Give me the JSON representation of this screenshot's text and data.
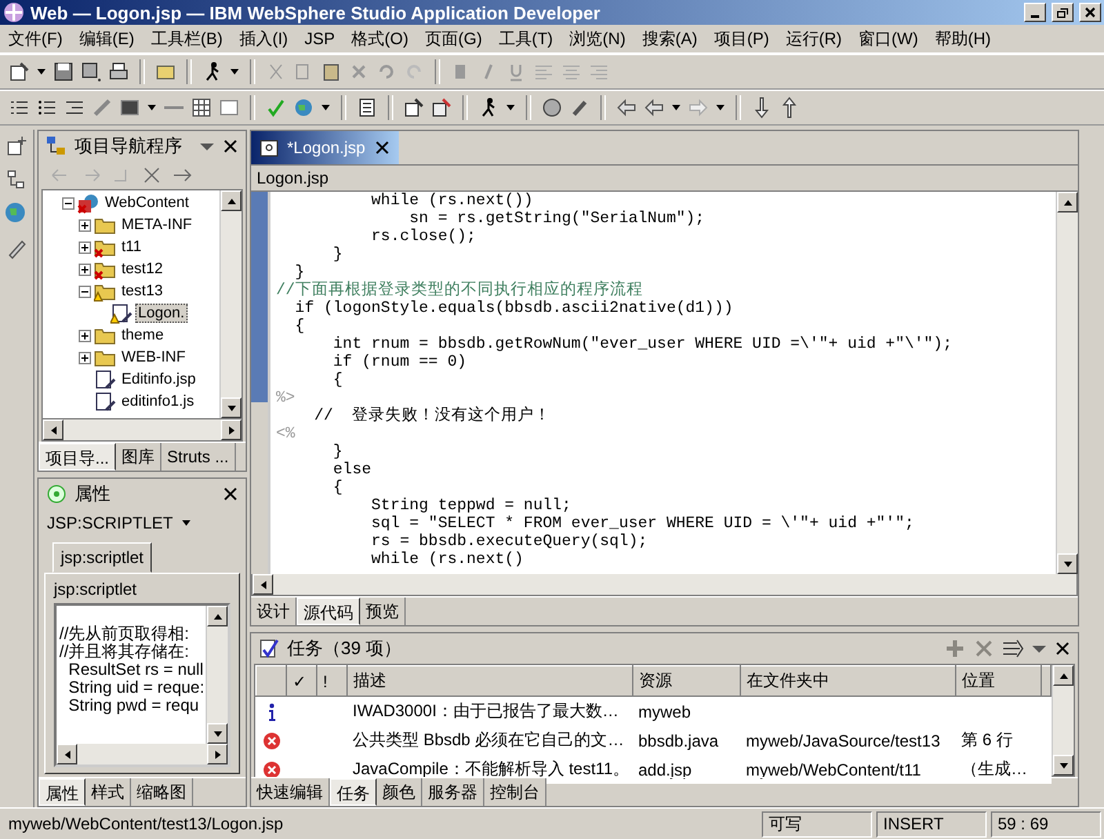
{
  "window": {
    "title": "Web — Logon.jsp — IBM WebSphere Studio Application Developer"
  },
  "menu": [
    "文件(F)",
    "编辑(E)",
    "工具栏(B)",
    "插入(I)",
    "JSP",
    "格式(O)",
    "页面(G)",
    "工具(T)",
    "浏览(N)",
    "搜索(A)",
    "项目(P)",
    "运行(R)",
    "窗口(W)",
    "帮助(H)"
  ],
  "navigator": {
    "title": "项目导航程序",
    "tree": [
      {
        "label": "WebContent",
        "kind": "project",
        "error": true,
        "warning": false,
        "expanded": true,
        "selected": false,
        "children": [
          {
            "label": "META-INF",
            "kind": "folder",
            "error": false,
            "warning": false,
            "expanded": false,
            "selected": false
          },
          {
            "label": "t11",
            "kind": "folder",
            "error": true,
            "warning": false,
            "expanded": false,
            "selected": false
          },
          {
            "label": "test12",
            "kind": "folder",
            "error": true,
            "warning": false,
            "expanded": false,
            "selected": false
          },
          {
            "label": "test13",
            "kind": "folder",
            "error": false,
            "warning": true,
            "expanded": true,
            "selected": false,
            "children": [
              {
                "label": "Logon.",
                "kind": "file",
                "error": false,
                "warning": true,
                "expanded": false,
                "selected": true
              }
            ]
          },
          {
            "label": "theme",
            "kind": "folder",
            "error": false,
            "warning": false,
            "expanded": false,
            "selected": false
          },
          {
            "label": "WEB-INF",
            "kind": "folder",
            "error": false,
            "warning": false,
            "expanded": false,
            "selected": false
          },
          {
            "label": "Editinfo.jsp",
            "kind": "file",
            "error": false,
            "warning": false,
            "expanded": false,
            "selected": false
          },
          {
            "label": "editinfo1.js",
            "kind": "file",
            "error": false,
            "warning": false,
            "expanded": false,
            "selected": false
          }
        ]
      }
    ],
    "tabs": [
      {
        "label": "项目导...",
        "selected": true
      },
      {
        "label": "图库",
        "selected": false
      },
      {
        "label": "Struts ...",
        "selected": false
      }
    ]
  },
  "properties": {
    "title": "属性",
    "element": "JSP:SCRIPTLET",
    "tab": "jsp:scriptlet",
    "label": "jsp:scriptlet",
    "lines": [
      "//先从前页取得相:",
      "//并且将其存储在:",
      "  ResultSet rs = null",
      "  String uid = reque:",
      "  String pwd = requ"
    ],
    "tabs": [
      {
        "label": "属性",
        "selected": true
      },
      {
        "label": "样式",
        "selected": false
      },
      {
        "label": "缩略图",
        "selected": false
      }
    ]
  },
  "editor": {
    "tab": "*Logon.jsp",
    "file": "Logon.jsp",
    "lines": [
      {
        "kind": "code",
        "text": "          while (rs.next())"
      },
      {
        "kind": "code",
        "text": "              sn = rs.getString(\"SerialNum\");"
      },
      {
        "kind": "code",
        "text": "          rs.close();"
      },
      {
        "kind": "code",
        "text": "      }"
      },
      {
        "kind": "code",
        "text": "  }"
      },
      {
        "kind": "comment",
        "text": "//下面再根据登录类型的不同执行相应的程序流程"
      },
      {
        "kind": "code",
        "text": "  if (logonStyle.equals(bbsdb.ascii2native(d1)))"
      },
      {
        "kind": "code",
        "text": "  {"
      },
      {
        "kind": "code",
        "text": "      int rnum = bbsdb.getRowNum(\"ever_user WHERE UID =\\'\"+ uid +\"\\'\");"
      },
      {
        "kind": "code",
        "text": "      if (rnum == 0)"
      },
      {
        "kind": "code",
        "text": "      {"
      },
      {
        "kind": "tag",
        "text": "%>"
      },
      {
        "kind": "code",
        "text": "    //  登录失败！没有这个用户！"
      },
      {
        "kind": "tag",
        "text": "<%"
      },
      {
        "kind": "code",
        "text": "      }"
      },
      {
        "kind": "code",
        "text": "      else"
      },
      {
        "kind": "code",
        "text": "      {"
      },
      {
        "kind": "code",
        "text": "          String teppwd = null;"
      },
      {
        "kind": "code",
        "text": "          sql = \"SELECT * FROM ever_user WHERE UID = \\'\"+ uid +\"'\";"
      },
      {
        "kind": "code",
        "text": "          rs = bbsdb.executeQuery(sql);"
      },
      {
        "kind": "code",
        "text": "          while (rs.next()"
      }
    ],
    "tabs": [
      {
        "label": "设计",
        "selected": false
      },
      {
        "label": "源代码",
        "selected": true
      },
      {
        "label": "预览",
        "selected": false
      }
    ]
  },
  "tasks": {
    "title": "任务（39 项）",
    "columns": [
      "✓",
      "!",
      "描述",
      "资源",
      "在文件夹中",
      "位置"
    ],
    "rows": [
      {
        "kind": "info",
        "description": "IWAD3000I：由于已报告了最大数…",
        "resource": "myweb"
      },
      {
        "kind": "error",
        "description": "公共类型 Bbsdb 必须在它自己的文…",
        "resource": "bbsdb.java",
        "folder": "myweb/JavaSource/test13",
        "location": "第 6 行"
      },
      {
        "kind": "error",
        "description": "JavaCompile：不能解析导入 test11。",
        "resource": "add.jsp",
        "folder": "myweb/WebContent/t11",
        "location": "（生成…"
      }
    ],
    "tabs": [
      {
        "label": "快速编辑",
        "selected": false
      },
      {
        "label": "任务",
        "selected": true
      },
      {
        "label": "颜色",
        "selected": false
      },
      {
        "label": "服务器",
        "selected": false
      },
      {
        "label": "控制台",
        "selected": false
      }
    ]
  },
  "status_bar": {
    "path": "myweb/WebContent/test13/Logon.jsp",
    "access": "可写",
    "mode": "INSERT",
    "position": "59 : 69"
  }
}
